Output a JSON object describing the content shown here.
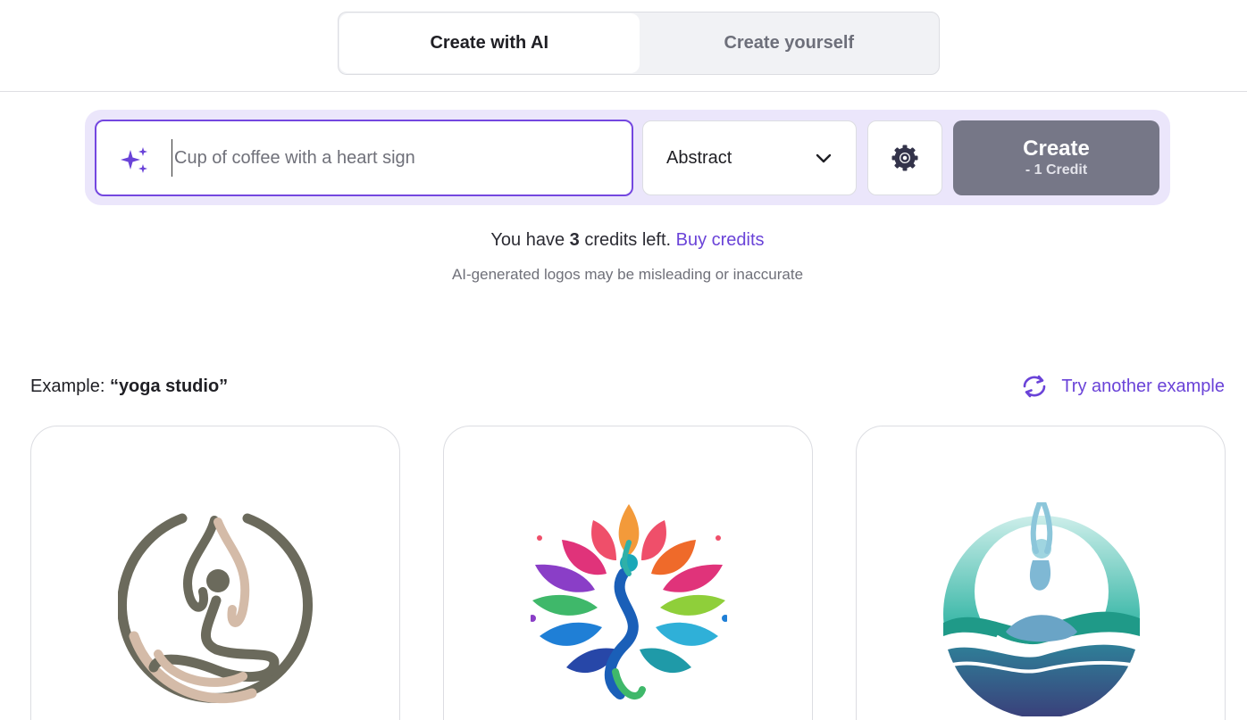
{
  "mode_tabs": {
    "active": "Create with AI",
    "inactive": "Create yourself"
  },
  "prompt": {
    "placeholder": "Cup of coffee with a heart sign",
    "value": ""
  },
  "style_select": {
    "selected": "Abstract"
  },
  "create_button": {
    "label": "Create",
    "cost": "- 1 Credit"
  },
  "credits": {
    "prefix": "You have",
    "count": "3",
    "suffix": "credits left.",
    "buy_link": "Buy credits",
    "disclaimer": "AI-generated logos may be misleading or inaccurate"
  },
  "example": {
    "label": "Example:",
    "query": "“yoga studio”",
    "try_another": "Try another example"
  },
  "icons": {
    "sparkle": "sparkle-icon",
    "chevron": "chevron-down-icon",
    "settings": "gear-icon",
    "refresh": "refresh-icon"
  },
  "colors": {
    "accent": "#6a43d8",
    "prompt_border": "#7447e0",
    "prompt_bar_bg": "#ebe6fb",
    "create_button_bg": "#767787"
  }
}
